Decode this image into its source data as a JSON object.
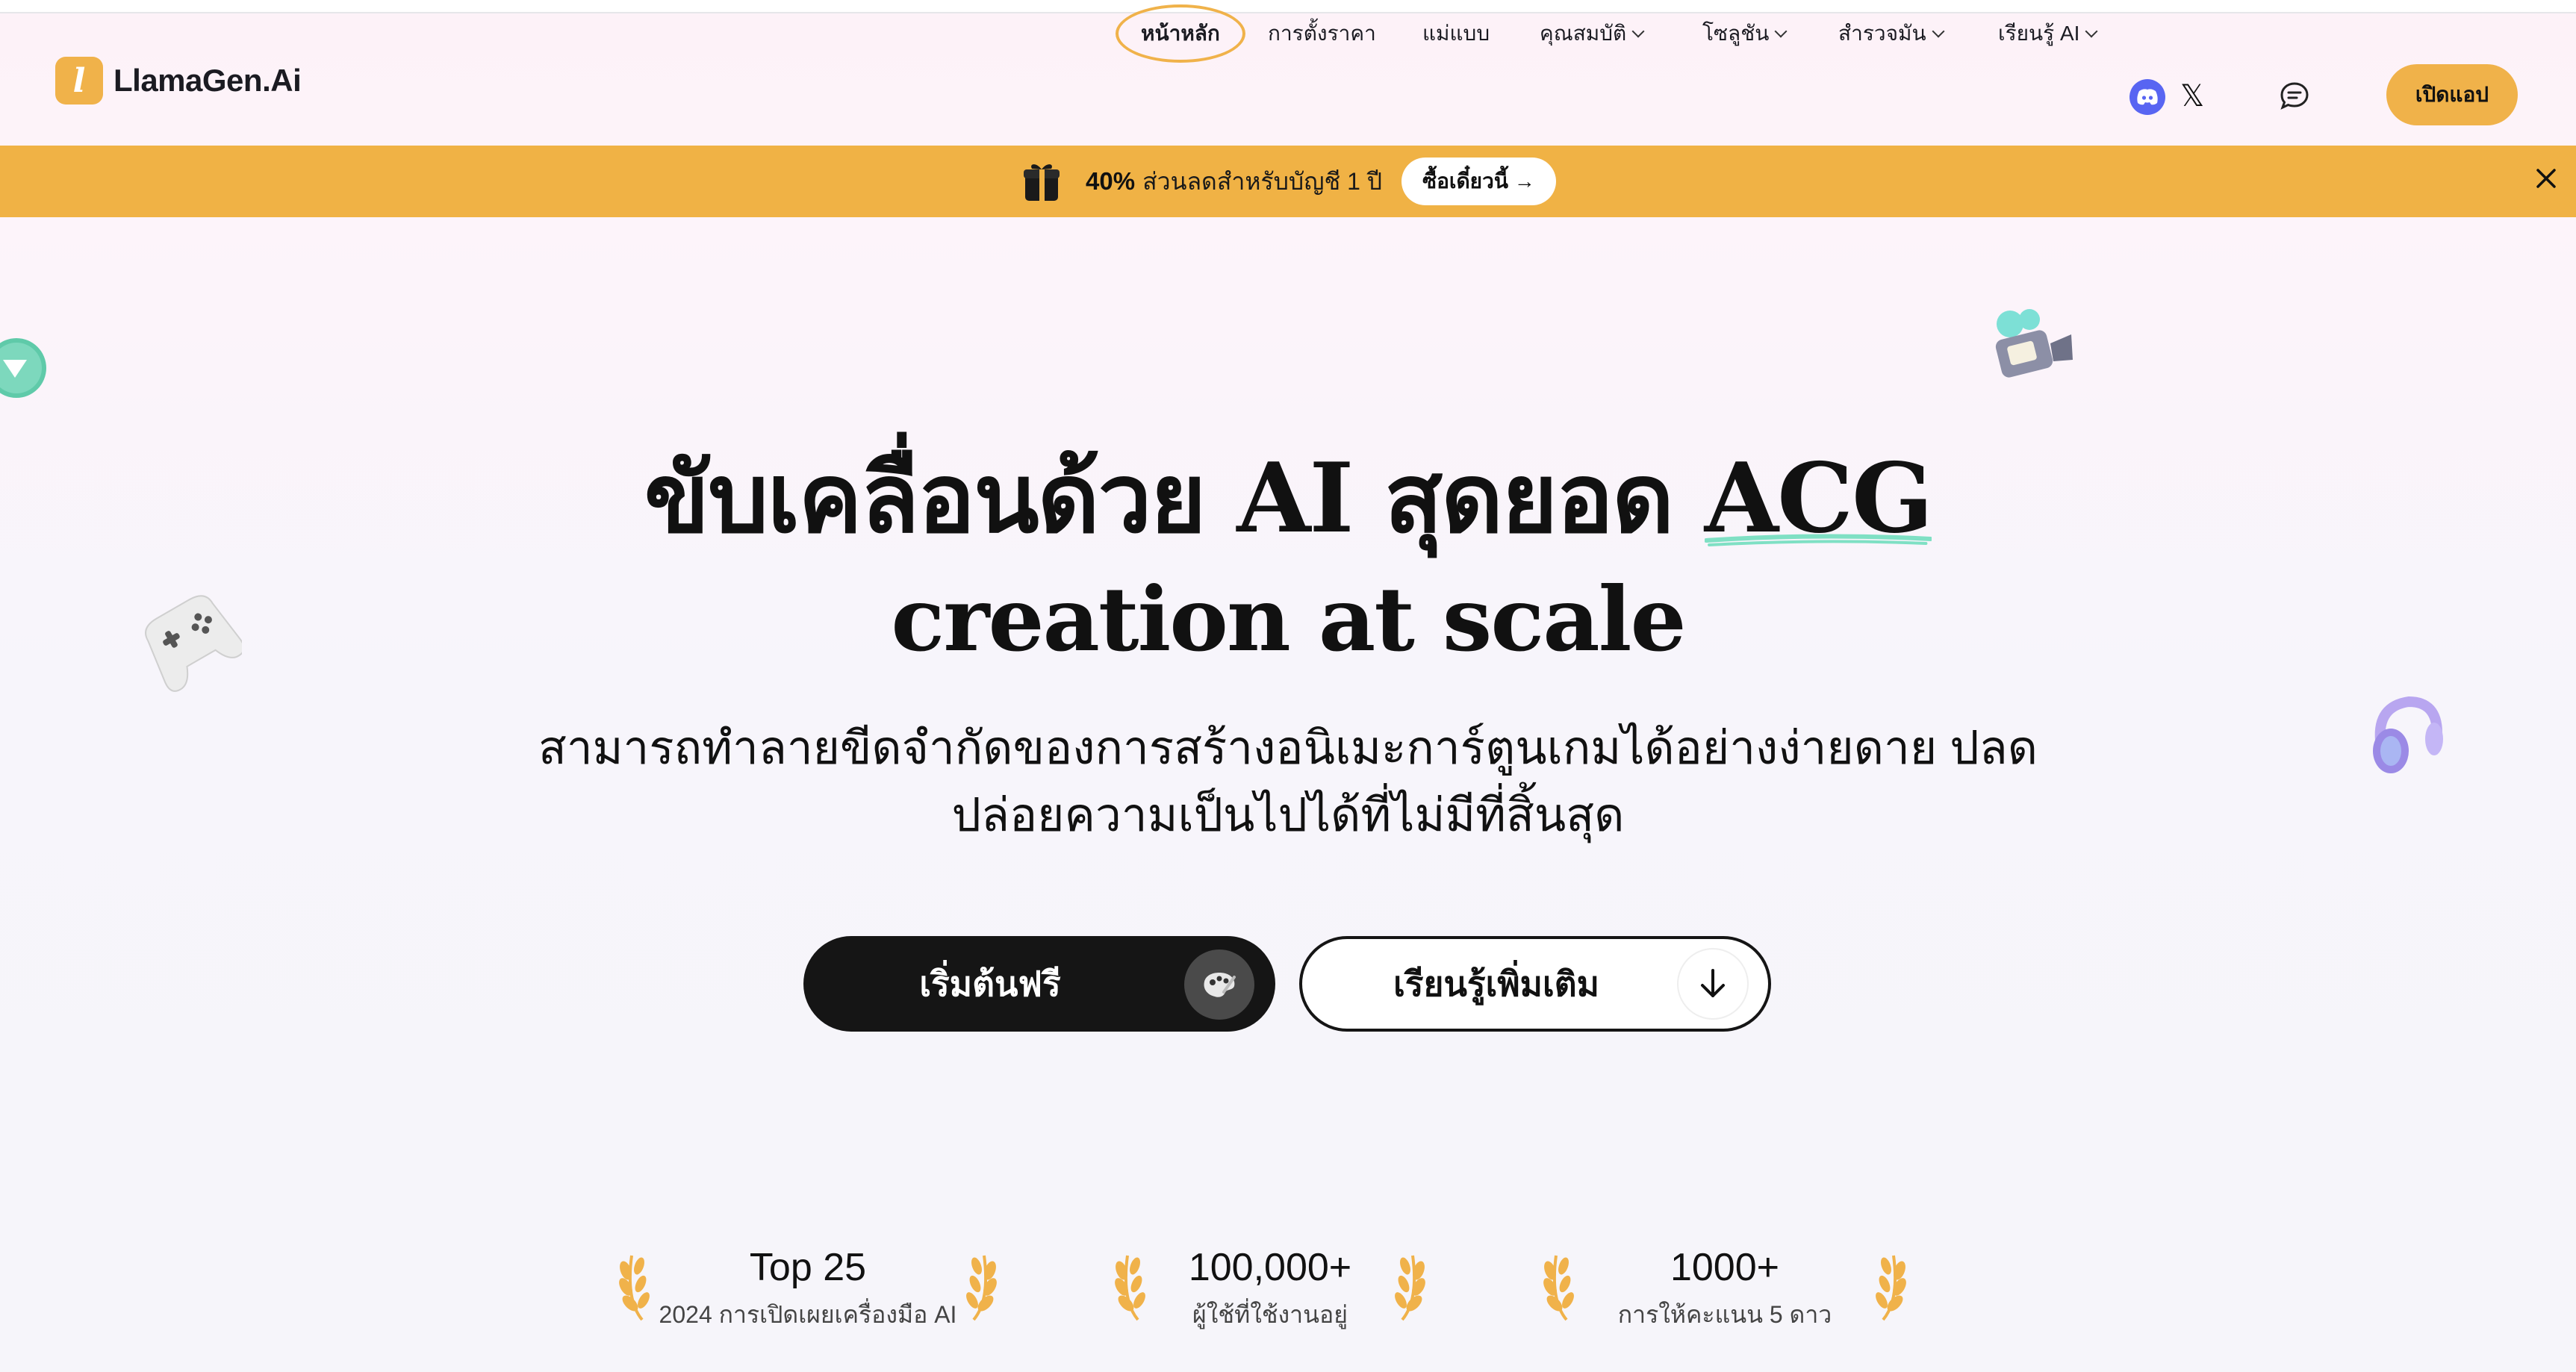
{
  "brand": {
    "name": "LlamaGen.Ai",
    "accent": "#f0b24a"
  },
  "nav": {
    "items": [
      {
        "label": "หน้าหลัก",
        "has_dropdown": false,
        "active": true
      },
      {
        "label": "การตั้งราคา",
        "has_dropdown": false
      },
      {
        "label": "แม่แบบ",
        "has_dropdown": false
      },
      {
        "label": "คุณสมบัติ",
        "has_dropdown": true
      },
      {
        "label": "โซลูชัน",
        "has_dropdown": true
      },
      {
        "label": "สำรวจมัน",
        "has_dropdown": true
      },
      {
        "label": "เรียนรู้ AI",
        "has_dropdown": true
      }
    ],
    "open_app": "เปิดแอป"
  },
  "banner": {
    "percent": "40%",
    "text": "ส่วนลดสำหรับบัญชี 1 ปี",
    "cta": "ซื้อเดี๋ยวนี้ →",
    "color": "#f0b245"
  },
  "hero": {
    "title_line1": "ขับเคลื่อนด้วย AI สุดยอด",
    "title_highlight": "ACG",
    "title_line2": "creation at scale",
    "subtitle_line1": "สามารถทำลายขีดจำกัดของการสร้างอนิเมะการ์ตูนเกมได้อย่างง่ายดาย ปลด",
    "subtitle_line2": "ปล่อยความเป็นไปได้ที่ไม่มีที่สิ้นสุด",
    "primary_cta": "เริ่มต้นฟรี",
    "secondary_cta": "เรียนรู้เพิ่มเติม"
  },
  "stats": [
    {
      "value": "Top 25",
      "label": "2024 การเปิดเผยเครื่องมือ AI"
    },
    {
      "value": "100,000+",
      "label": "ผู้ใช้ที่ใช้งานอยู่"
    },
    {
      "value": "1000+",
      "label": "การให้คะแนน 5 ดาว"
    }
  ]
}
